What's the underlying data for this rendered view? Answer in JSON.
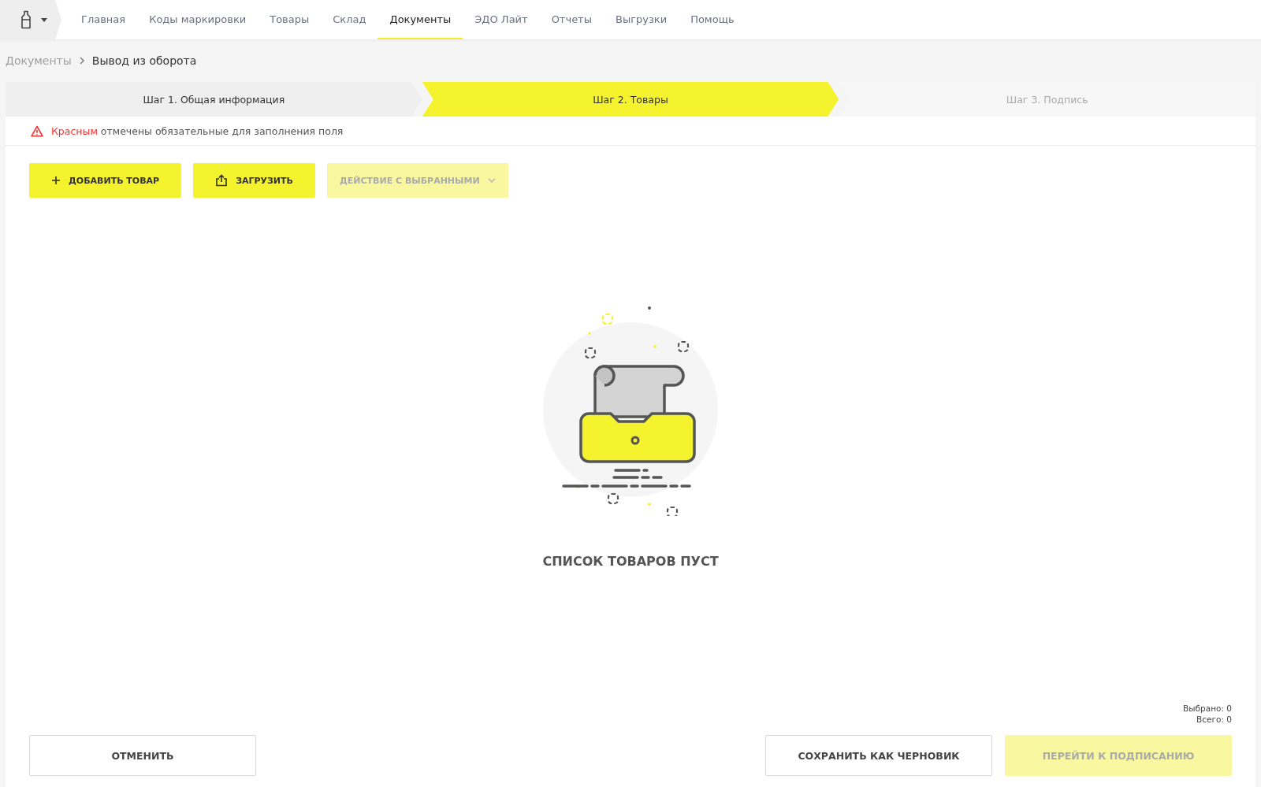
{
  "nav": {
    "items": [
      {
        "label": "Главная",
        "selected": false
      },
      {
        "label": "Коды маркировки",
        "selected": false
      },
      {
        "label": "Товары",
        "selected": false
      },
      {
        "label": "Склад",
        "selected": false
      },
      {
        "label": "Документы",
        "selected": true
      },
      {
        "label": "ЭДО Лайт",
        "selected": false
      },
      {
        "label": "Отчеты",
        "selected": false
      },
      {
        "label": "Выгрузки",
        "selected": false
      },
      {
        "label": "Помощь",
        "selected": false
      }
    ]
  },
  "breadcrumb": [
    {
      "label": "Документы"
    },
    {
      "label": "Вывод из оборота"
    }
  ],
  "steps": [
    {
      "label": "Шаг 1. Общая информация",
      "selected": false,
      "disabled": false
    },
    {
      "label": "Шаг 2. Товары",
      "selected": true,
      "disabled": false
    },
    {
      "label": "Шаг 3. Подпись",
      "selected": false,
      "disabled": true
    }
  ],
  "notice": {
    "highlight": "Красным",
    "text": "отмечены обязательные для заполнения поля"
  },
  "toolbar": [
    {
      "kind": "add",
      "label": "ДОБАВИТЬ ТОВАР",
      "disabled": false
    },
    {
      "kind": "upload",
      "label": "ЗАГРУЗИТЬ",
      "disabled": false
    },
    {
      "kind": "dropdown",
      "label": "ДЕЙСТВИЕ С ВЫБРАННЫМИ",
      "disabled": true
    }
  ],
  "empty_state": {
    "title": "СПИСОК ТОВАРОВ ПУСТ"
  },
  "counts": [
    "Выбрано: 0",
    "Всего: 0"
  ],
  "footer": {
    "left": [
      {
        "label": "ОТМЕНИТЬ",
        "primary": false,
        "disabled": false
      }
    ],
    "right": [
      {
        "label": "СОХРАНИТЬ КАК ЧЕРНОВИК",
        "primary": false,
        "disabled": false
      },
      {
        "label": "ПЕРЕЙТИ К ПОДПИСАНИЮ",
        "primary": true,
        "disabled": true
      }
    ]
  }
}
